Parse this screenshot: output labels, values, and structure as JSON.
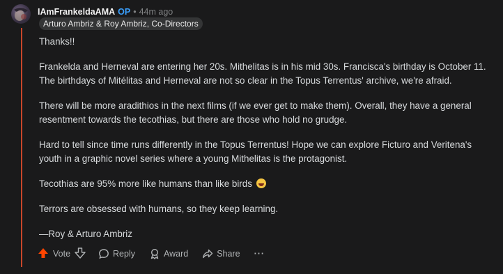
{
  "comment": {
    "username": "IAmFrankeldaAMA",
    "op_badge": "OP",
    "separator": "•",
    "timestamp": "44m ago",
    "flair": "Arturo Ambriz & Roy Ambriz, Co-Directors",
    "paragraphs": [
      "Thanks!!",
      "Frankelda and Herneval are entering her 20s. Mithelitas is in his mid 30s. Francisca's birthday is October 11. The birthdays of Mitélitas and Herneval are not so clear in the Topus Terrentus' archive, we're afraid.",
      "There will be more aradithios in the next films (if we ever get to make them). Overall, they have a general resentment towards the tecothias, but there are those who hold no grudge.",
      "Hard to tell since time runs differently in the Topus Terrentus! Hope we can explore Ficturo and Veritena's youth in a graphic novel series where a young Mithelitas is the protagonist.",
      "Tecothias are 95% more like humans than like birds",
      "Terrors are obsessed with humans, so they keep learning.",
      "—Roy & Arturo Ambriz"
    ],
    "emoji_icon": "grinning-face-emoji"
  },
  "actions": {
    "vote": "Vote",
    "reply": "Reply",
    "award": "Award",
    "share": "Share",
    "more": "···"
  },
  "colors": {
    "background": "#1a1a1b",
    "thread_line": "#c8462a",
    "upvote": "#ff4500",
    "op_badge": "#3aa0ff"
  }
}
